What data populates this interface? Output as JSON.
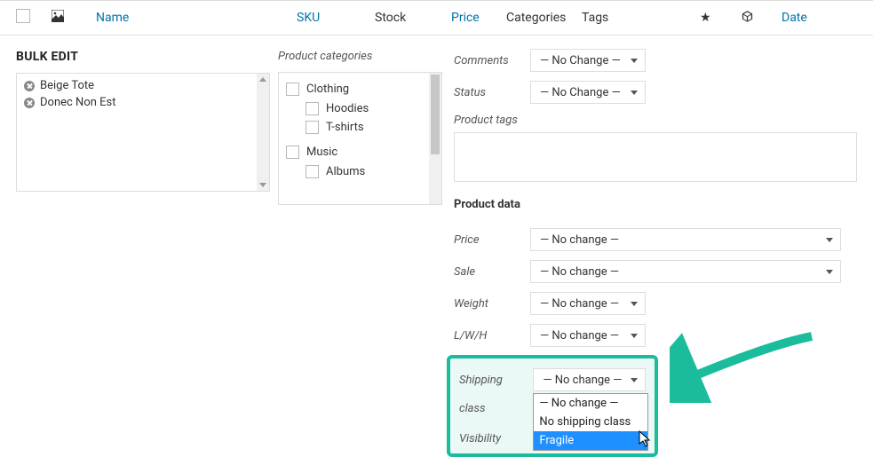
{
  "table_headers": {
    "name": "Name",
    "sku": "SKU",
    "stock": "Stock",
    "price": "Price",
    "categories": "Categories",
    "tags": "Tags",
    "date": "Date"
  },
  "bulk_edit": {
    "title": "BULK EDIT",
    "items": [
      "Beige Tote",
      "Donec Non Est"
    ]
  },
  "categories": {
    "title": "Product categories",
    "items": [
      {
        "label": "Clothing",
        "children": [
          {
            "label": "Hoodies"
          },
          {
            "label": "T-shirts"
          }
        ]
      },
      {
        "label": "Music",
        "children": [
          {
            "label": "Albums"
          }
        ]
      }
    ]
  },
  "right": {
    "comments": {
      "label": "Comments",
      "value": "— No Change —"
    },
    "status": {
      "label": "Status",
      "value": "— No Change —"
    },
    "tags_label": "Product tags",
    "data_label": "Product data",
    "price": {
      "label": "Price",
      "value": "— No change —"
    },
    "sale": {
      "label": "Sale",
      "value": "— No change —"
    },
    "weight": {
      "label": "Weight",
      "value": "— No change —"
    },
    "lwh": {
      "label": "L/W/H",
      "value": "— No change —"
    },
    "shipping": {
      "label": "Shipping class",
      "value": "— No change —",
      "options": [
        "— No change —",
        "No shipping class",
        "Fragile"
      ]
    },
    "visibility": {
      "label": "Visibility"
    }
  }
}
